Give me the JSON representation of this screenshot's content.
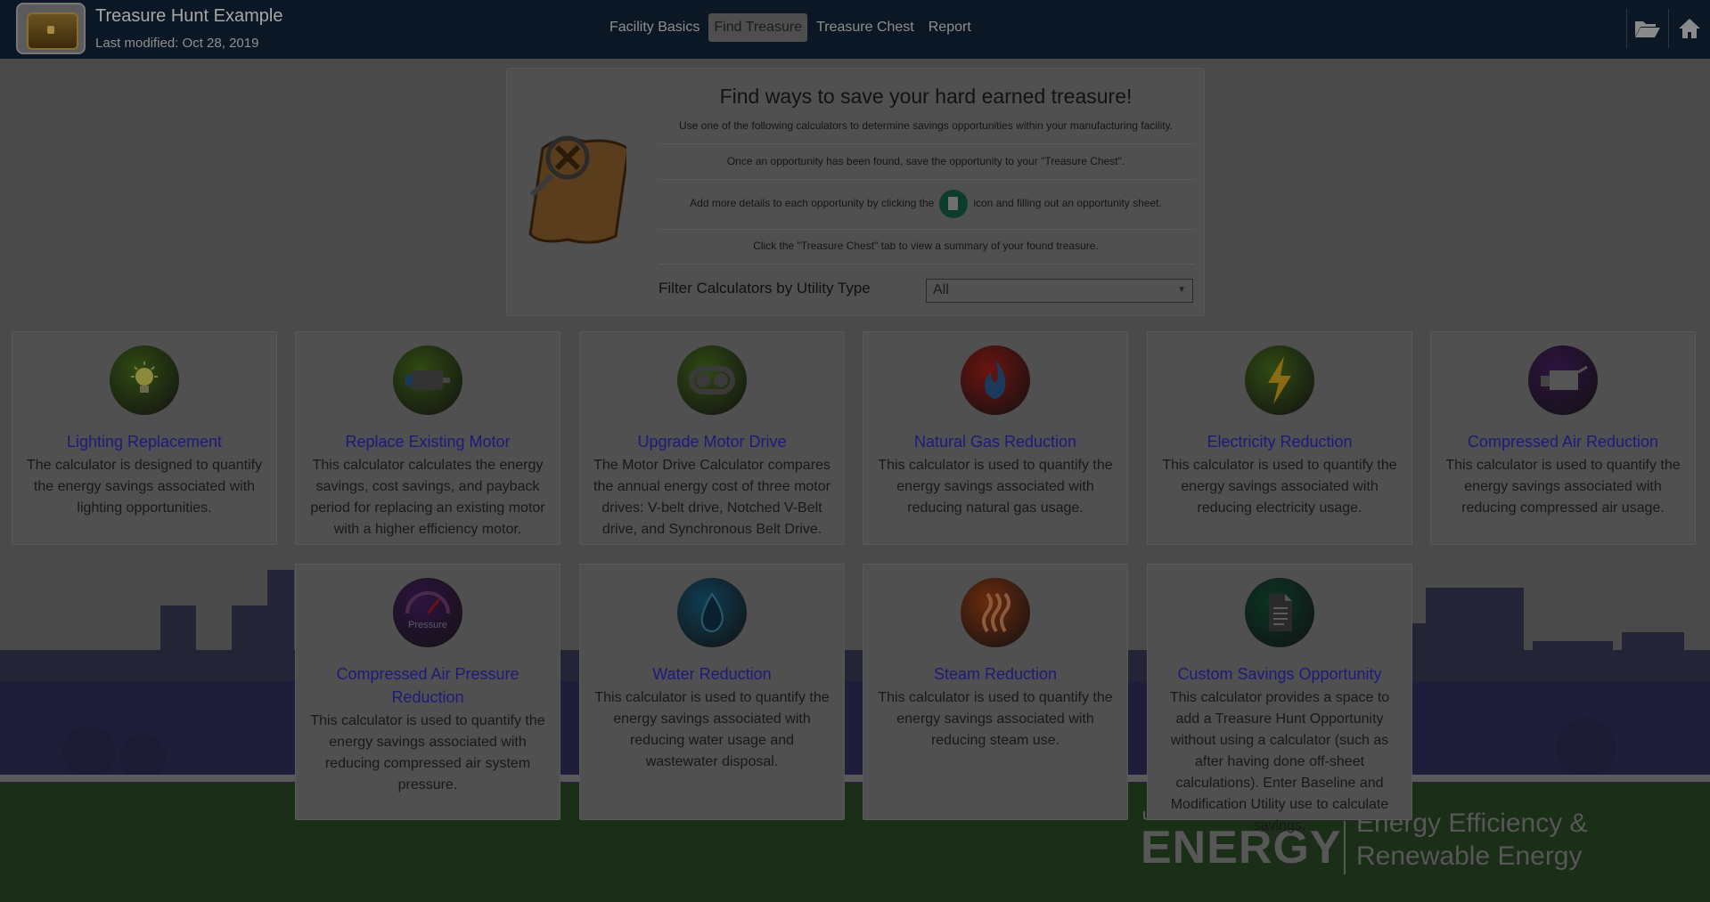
{
  "header": {
    "title": "Treasure Hunt Example",
    "modified": "Last modified: Oct 28, 2019",
    "tabs": [
      {
        "label": "Facility Basics"
      },
      {
        "label": "Find Treasure"
      },
      {
        "label": "Treasure Chest"
      },
      {
        "label": "Report"
      }
    ],
    "active_tab": "Find Treasure",
    "icons": [
      "folder-open-icon",
      "home-icon"
    ]
  },
  "intro": {
    "title": "Find ways to save your hard earned treasure!",
    "line1": "Use one of the following calculators to determine savings opportunities within your manufacturing facility.",
    "line2": "Once an opportunity has been found, save the opportunity to your \"Treasure Chest\".",
    "line3_before": "Add more details to each opportunity by clicking the",
    "line3_after": "icon and filling out an opportunity sheet.",
    "line4": "Click the \"Treasure Chest\" tab to view a summary of your found treasure.",
    "filter_label": "Filter Calculators by Utility Type",
    "filter_value": "All"
  },
  "cards": [
    {
      "title": "Lighting Replacement",
      "desc": "The calculator is designed to quantify the energy savings associated with lighting opportunities.",
      "icon": "lightbulb-icon",
      "color": "#2f4a12"
    },
    {
      "title": "Replace Existing Motor",
      "desc": "This calculator calculates the energy savings, cost savings, and payback period for replacing an existing motor with a higher efficiency motor.",
      "icon": "motor-icon",
      "color": "#2f4a12"
    },
    {
      "title": "Upgrade Motor Drive",
      "desc": "The Motor Drive Calculator compares the annual energy cost of three motor drives: V-belt drive, Notched V-Belt drive, and Synchronous Belt Drive.",
      "icon": "belt-drive-icon",
      "color": "#2f4a12"
    },
    {
      "title": "Natural Gas Reduction",
      "desc": "This calculator is used to quantify the energy savings associated with reducing natural gas usage.",
      "icon": "flame-icon",
      "color": "#6a1410"
    },
    {
      "title": "Electricity Reduction",
      "desc": "This calculator is used to quantify the energy savings associated with reducing electricity usage.",
      "icon": "lightning-icon",
      "color": "#2f4a12"
    },
    {
      "title": "Compressed Air Reduction",
      "desc": "This calculator is used to quantify the energy savings associated with reducing compressed air usage.",
      "icon": "compressor-icon",
      "color": "#2e1340"
    },
    {
      "title": "Compressed Air Pressure Reduction",
      "desc": "This calculator is used to quantify the energy savings associated with reducing compressed air system pressure.",
      "icon": "pressure-gauge-icon",
      "color": "#2e1340",
      "icon_text": "Pressure"
    },
    {
      "title": "Water Reduction",
      "desc": "This calculator is used to quantify the energy savings associated with reducing water usage and wastewater disposal.",
      "icon": "water-drop-icon",
      "color": "#0f3d52"
    },
    {
      "title": "Steam Reduction",
      "desc": "This calculator is used to quantify the energy savings associated with reducing steam use.",
      "icon": "steam-icon",
      "color": "#6a2a0e"
    },
    {
      "title": "Custom Savings Opportunity",
      "desc": "This calculator provides a space to add a Treasure Hunt Opportunity without using a calculator (such as after having done off-sheet calculations). Enter Baseline and Modification Utility use to calculate savings.",
      "icon": "document-icon",
      "color": "#0b3524"
    }
  ],
  "footer": {
    "dept": "U.S. DEPARTMENT OF",
    "energy": "ENERGY",
    "sub1": "Energy Efficiency &",
    "sub2": "Renewable Energy"
  }
}
